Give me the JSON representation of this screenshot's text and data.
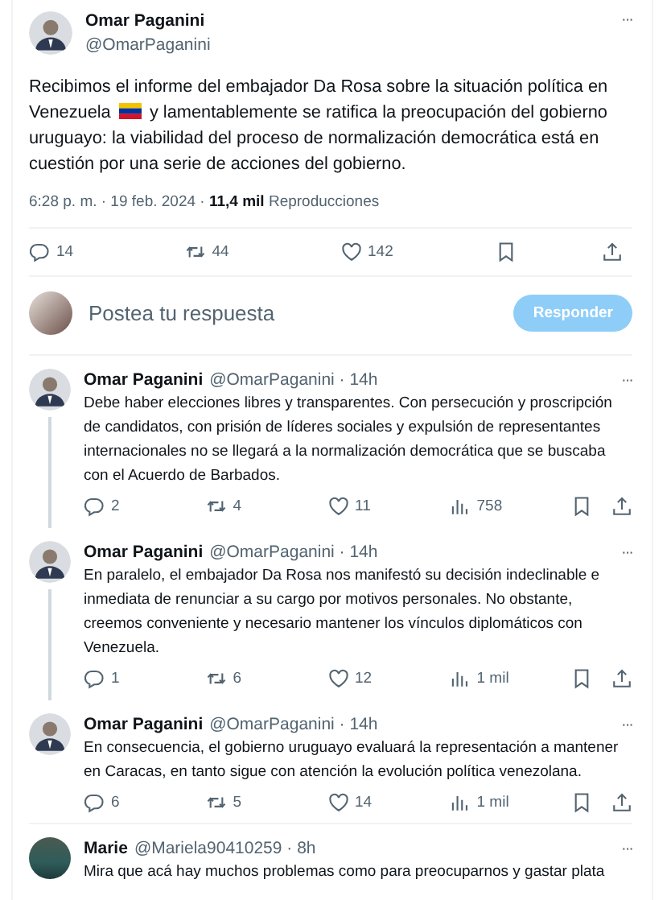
{
  "main_post": {
    "author": "Omar Paganini",
    "handle": "@OmarPaganini",
    "more": "···",
    "text_before": "Recibimos el informe del embajador Da Rosa sobre la situación política en Venezuela",
    "text_after": "y lamentablemente se ratifica la preocupación del gobierno uruguayo: la viabilidad del proceso de normalización democrática está en cuestión por una serie de acciones del gobierno.",
    "time": "6:28 p. m. · 19 feb. 2024 · ",
    "views": "11,4 mil",
    "views_label": "Reproducciones",
    "actions": [
      {
        "kind": "reply",
        "count": "14"
      },
      {
        "kind": "repost",
        "count": "44"
      },
      {
        "kind": "like",
        "count": "142"
      },
      {
        "kind": "bookmark"
      },
      {
        "kind": "share"
      }
    ]
  },
  "reply_box": {
    "placeholder": "Postea tu respuesta",
    "button": "Responder",
    "disabled": true
  },
  "replies": [
    {
      "author": "Omar Paganini",
      "handle": "@OmarPaganini · 14h",
      "more": "···",
      "kind": "person",
      "thread_line": true,
      "text": "Debe haber elecciones libres y transparentes. Con persecución y proscripción de candidatos, con prisión de líderes sociales y expulsión de representantes internacionales no se llegará a la normalización democrática que se buscaba con el Acuerdo de Barbados.",
      "actions": [
        {
          "kind": "reply",
          "count": "2"
        },
        {
          "kind": "repost",
          "count": "4"
        },
        {
          "kind": "like",
          "count": "11"
        },
        {
          "kind": "views",
          "count": "758"
        },
        {
          "kind": "bookmark"
        },
        {
          "kind": "share"
        }
      ]
    },
    {
      "author": "Omar Paganini",
      "handle": "@OmarPaganini · 14h",
      "more": "···",
      "kind": "person",
      "thread_line": true,
      "text": "En paralelo, el embajador Da Rosa nos manifestó su decisión indeclinable e inmediata de renunciar a su cargo por motivos personales. No obstante, creemos conveniente y necesario mantener los vínculos diplomáticos con Venezuela.",
      "actions": [
        {
          "kind": "reply",
          "count": "1"
        },
        {
          "kind": "repost",
          "count": "6"
        },
        {
          "kind": "like",
          "count": "12"
        },
        {
          "kind": "views",
          "count": "1 mil"
        },
        {
          "kind": "bookmark"
        },
        {
          "kind": "share"
        }
      ]
    },
    {
      "author": "Omar Paganini",
      "handle": "@OmarPaganini · 14h",
      "more": "···",
      "kind": "person",
      "thread_line": false,
      "text": "En consecuencia, el gobierno uruguayo evaluará la representación a mantener en Caracas, en tanto sigue con atención la evolución política venezolana.",
      "actions": [
        {
          "kind": "reply",
          "count": "6"
        },
        {
          "kind": "repost",
          "count": "5"
        },
        {
          "kind": "like",
          "count": "14"
        },
        {
          "kind": "views",
          "count": "1 mil"
        },
        {
          "kind": "bookmark"
        },
        {
          "kind": "share"
        }
      ]
    },
    {
      "author": "Marie",
      "handle": "@Mariela90410259 · 8h",
      "more": "···",
      "kind": "photo",
      "thread_line": false,
      "separated": true,
      "text": "Mira que acá hay muchos problemas como para preocuparnos y gastar plata"
    }
  ]
}
